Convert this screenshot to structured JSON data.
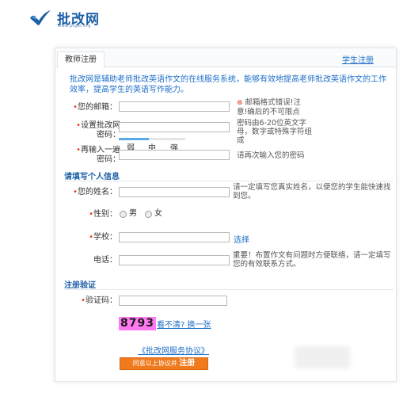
{
  "logo": {
    "title": "批改网",
    "url": "www.pigai.org",
    "colors": {
      "blue": "#1e5fa8",
      "light_blue": "#5aa9e6"
    }
  },
  "tabs": {
    "teacher": "教师注册",
    "student": "学生注册"
  },
  "intro": "批改网是辅助老师批改英语作文的在线服务系统，能够有效地提高老师批改英语作文的工作效率，提高学生的英语写作能力。",
  "form": {
    "email": {
      "label": "您的邮箱：",
      "error_icon": "⊗",
      "hint": "邮箱格式错误!注意!确后的不可限点"
    },
    "password": {
      "label": "设置批改网密码：",
      "hint": "密码由6-20位英文字母，数字或特殊字符组成",
      "strength": {
        "weak": "弱",
        "medium": "中",
        "strong": "强",
        "level": 0.45
      }
    },
    "confirm": {
      "label": "再输入一遍密码：",
      "hint": "请再次输入您的密码"
    }
  },
  "personal": {
    "title": "请填写个人信息",
    "name": {
      "label": "您的姓名：",
      "hint": "请一定填写您真实姓名，以便您的学生能快速找到您。"
    },
    "gender": {
      "label": "性别：",
      "male": "男",
      "female": "女"
    },
    "school": {
      "label": "学校：",
      "select": "选择"
    },
    "phone": {
      "label": "电话：",
      "hint": "重要！布置作文有问题时方便联络，请一定填写您的有效联系方式。"
    }
  },
  "verify": {
    "title": "注册验证",
    "label": "验证码：",
    "captcha": "8793",
    "refresh": "看不清? 换一张"
  },
  "agreement": "《批改网服务协议》",
  "submit": {
    "prefix": "同意以上协议并",
    "action": "注册"
  }
}
